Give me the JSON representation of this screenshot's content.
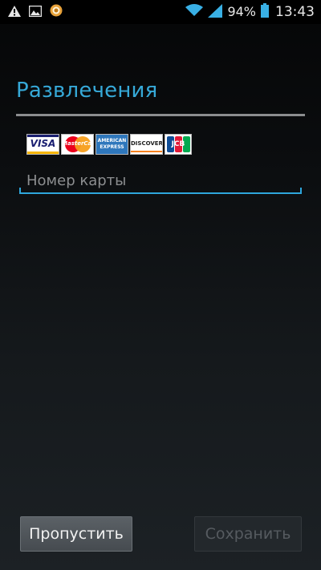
{
  "status_bar": {
    "battery_percent": "94%",
    "time": "13:43",
    "icons": [
      "warning-icon",
      "image-icon",
      "app-notification-icon",
      "wifi-icon",
      "signal-icon",
      "battery-icon"
    ]
  },
  "dialog": {
    "title": "Развлечения",
    "accent_color": "#36a9d8"
  },
  "card_logos": {
    "visa": "VISA",
    "mastercard": "MasterCard",
    "amex": "AMERICAN EXPRESS",
    "discover": "DISCOVER",
    "jcb": "JCB"
  },
  "card_number_field": {
    "placeholder": "Номер карты",
    "value": ""
  },
  "buttons": {
    "skip_label": "Пропустить",
    "save_label": "Сохранить"
  }
}
